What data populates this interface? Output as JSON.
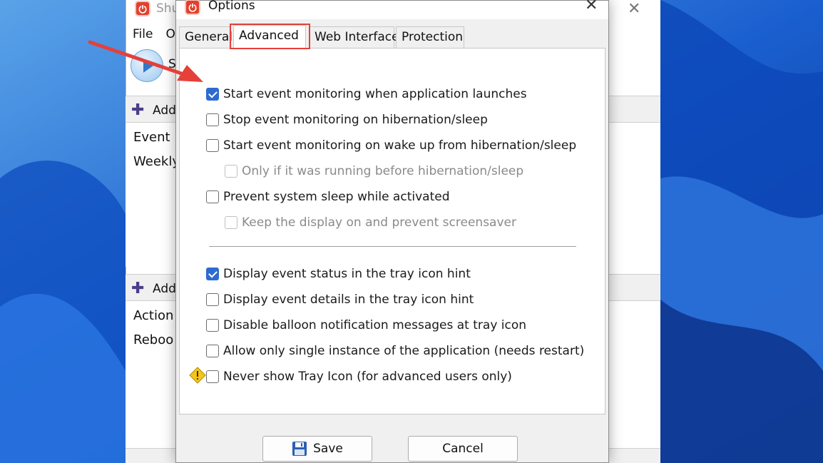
{
  "background_window": {
    "title_fragment": "Shu",
    "menu": [
      "File",
      "O"
    ],
    "toolbar_fragment": "S",
    "events_add_label": "Add",
    "events_list": [
      "Event",
      "Weekly"
    ],
    "actions_add_label": "Add",
    "actions_list": [
      "Action",
      "Reboo"
    ]
  },
  "dialog": {
    "title": "Options",
    "tabs": [
      {
        "label": "General",
        "active": false
      },
      {
        "label": "Advanced",
        "active": true
      },
      {
        "label": "Web Interface",
        "active": false
      },
      {
        "label": "Protection",
        "active": false
      }
    ],
    "options": [
      {
        "label": "Start event monitoring when application launches",
        "checked": true,
        "enabled": true
      },
      {
        "label": "Stop event monitoring on hibernation/sleep",
        "checked": false,
        "enabled": true
      },
      {
        "label": "Start event monitoring on wake up from hibernation/sleep",
        "checked": false,
        "enabled": true
      },
      {
        "label": "Only if it was running before hibernation/sleep",
        "checked": false,
        "enabled": false
      },
      {
        "label": "Prevent system sleep while activated",
        "checked": false,
        "enabled": true
      },
      {
        "label": "Keep the display on and prevent screensaver",
        "checked": false,
        "enabled": false
      },
      {
        "label": "Display event status in the tray icon hint",
        "checked": true,
        "enabled": true
      },
      {
        "label": "Display event details in the tray icon hint",
        "checked": false,
        "enabled": true
      },
      {
        "label": "Disable balloon notification messages at tray icon",
        "checked": false,
        "enabled": true
      },
      {
        "label": "Allow only single instance of the application (needs restart)",
        "checked": false,
        "enabled": true
      },
      {
        "label": "Never show Tray Icon (for advanced users only)",
        "checked": false,
        "enabled": true
      }
    ],
    "save_label": "Save",
    "cancel_label": "Cancel"
  },
  "colors": {
    "checkbox_checked": "#2e6bd1",
    "annotation_red": "#e5403a",
    "app_icon": "#e2402d"
  },
  "icons": [
    "app-icon",
    "close-icon",
    "play-icon",
    "plus-icon",
    "warning-icon",
    "save-icon",
    "annotation-arrow"
  ]
}
